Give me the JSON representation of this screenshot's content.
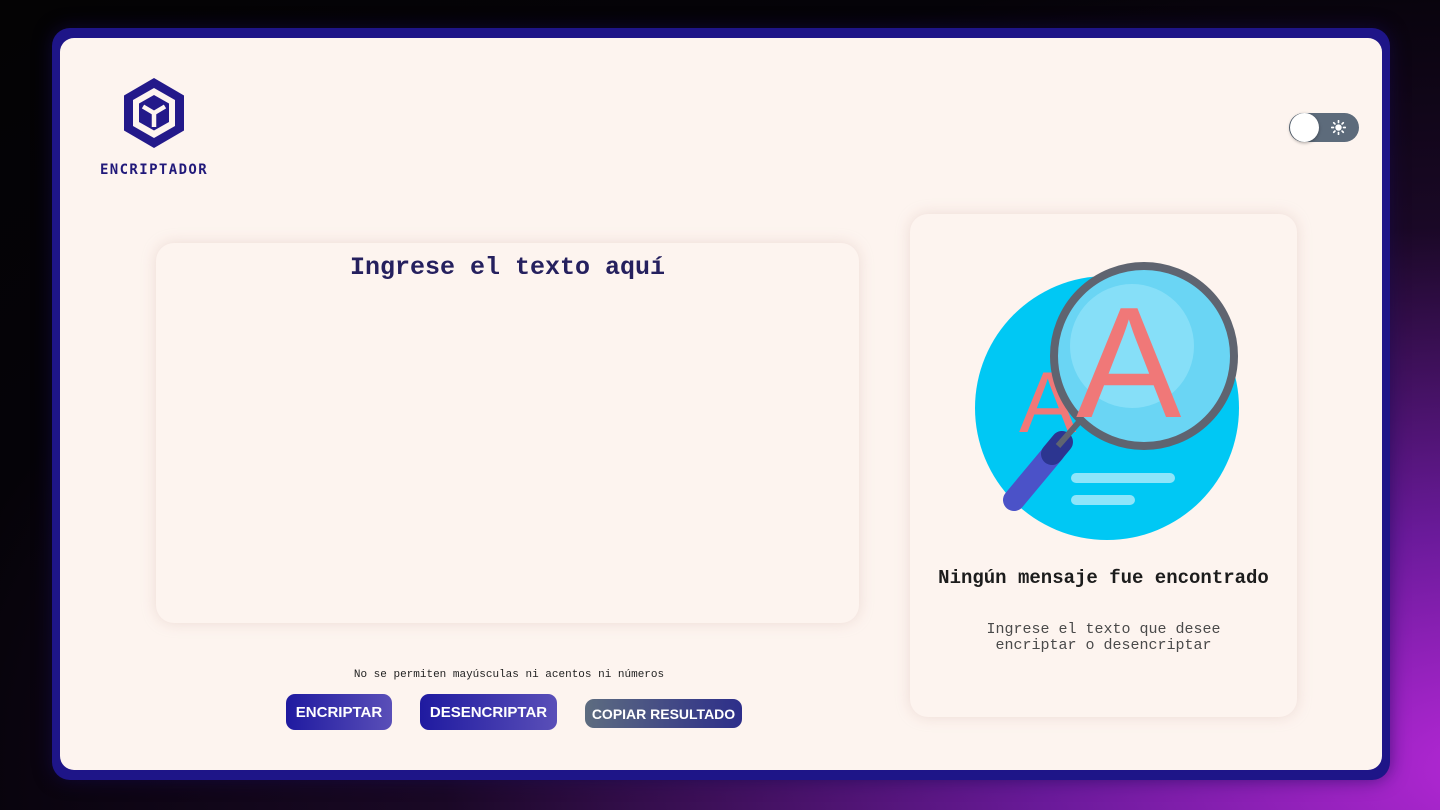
{
  "app": {
    "logo_text": "ENCRIPTADOR",
    "theme_toggle": {
      "state": "light",
      "icon": "sun-icon"
    }
  },
  "input": {
    "placeholder": "Ingrese el texto aquí",
    "value": ""
  },
  "hint": "No se permiten mayúsculas ni acentos ni números",
  "buttons": {
    "encrypt": "ENCRIPTAR",
    "decrypt": "DESENCRIPTAR",
    "copy": "COPIAR RESULTADO"
  },
  "result": {
    "illustration_icon": "magnifier-text-icon",
    "title": "Ningún mensaje fue encontrado",
    "description": "Ingrese el texto que desee encriptar o desencriptar"
  },
  "colors": {
    "primary": "#1f1aa0",
    "panel_bg": "#fdf4ef",
    "frame": "#1e1588",
    "copy_button": "#5d6c80"
  }
}
